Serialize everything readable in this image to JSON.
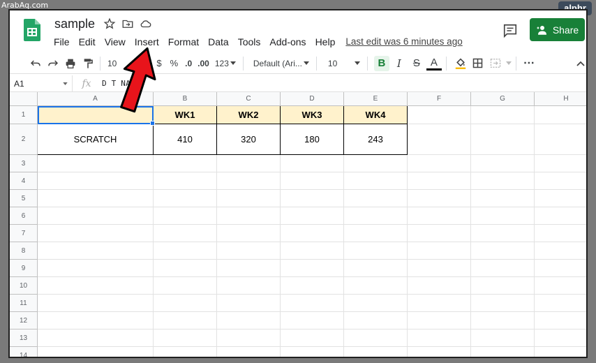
{
  "watermark": "ArabAq.com",
  "brand_badge": "alphr",
  "doc": {
    "title": "sample",
    "last_edit": "Last edit was 6 minutes ago"
  },
  "menu": [
    "File",
    "Edit",
    "View",
    "Insert",
    "Format",
    "Data",
    "Tools",
    "Add-ons",
    "Help"
  ],
  "share_label": "Share",
  "toolbar": {
    "zoom": "10",
    "currency": "$",
    "percent": "%",
    "dec_less": ".0",
    "dec_more": ".00",
    "more_formats": "123",
    "font": "Default (Ari...",
    "font_size": "10",
    "bold": "B",
    "italic": "I",
    "strike": "S",
    "text_color": "A",
    "more": "⋯"
  },
  "formula_bar": {
    "cell_ref": "A1",
    "fx": "fx",
    "value": "D  T NAME"
  },
  "columns": [
    "A",
    "B",
    "C",
    "D",
    "E",
    "F",
    "G",
    "H"
  ],
  "rows": [
    "1",
    "2",
    "3",
    "4",
    "5",
    "6",
    "7",
    "8",
    "9",
    "10",
    "11",
    "12",
    "13",
    "14"
  ],
  "table": {
    "header": [
      "",
      "WK1",
      "WK2",
      "WK3",
      "WK4"
    ],
    "row2": [
      "SCRATCH",
      "410",
      "320",
      "180",
      "243"
    ]
  },
  "colors": {
    "share_green": "#188038",
    "header_fill": "#fff2cc",
    "selection_blue": "#1a73e8",
    "arrow_red": "#e8141b"
  }
}
